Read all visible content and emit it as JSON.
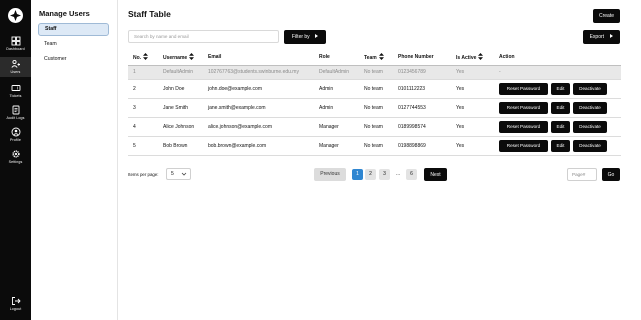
{
  "nav": {
    "items": [
      {
        "label": "Dashboard",
        "icon": "dashboard-icon"
      },
      {
        "label": "Users",
        "icon": "users-icon"
      },
      {
        "label": "Tickets",
        "icon": "ticket-icon"
      },
      {
        "label": "Audit Logs",
        "icon": "audit-log-icon"
      },
      {
        "label": "Profile",
        "icon": "profile-icon"
      },
      {
        "label": "Settings",
        "icon": "settings-icon"
      }
    ],
    "logout_label": "Logout"
  },
  "sidebar": {
    "title": "Manage Users",
    "items": [
      {
        "label": "Staff"
      },
      {
        "label": "Team"
      },
      {
        "label": "Customer"
      }
    ]
  },
  "main": {
    "title": "Staff Table",
    "create_label": "Create",
    "search_placeholder": "Search by name and email",
    "filter_label": "Filter by",
    "export_label": "Export"
  },
  "table": {
    "columns": [
      "No.",
      "Username",
      "Email",
      "Role",
      "Team",
      "Phone Number",
      "Is Active",
      "Action"
    ],
    "rows": [
      {
        "no": "1",
        "username": "DefaultAdmin",
        "email": "102767763@students.swinburne.edu.my",
        "role": "DefaultAdmin",
        "team": "No team",
        "phone": "0123456789",
        "active": "Yes",
        "action": "-"
      },
      {
        "no": "2",
        "username": "John Doe",
        "email": "john.doe@example.com",
        "role": "Admin",
        "team": "No team",
        "phone": "0101112223",
        "active": "Yes"
      },
      {
        "no": "3",
        "username": "Jane Smith",
        "email": "jane.smith@example.com",
        "role": "Admin",
        "team": "No team",
        "phone": "0127744553",
        "active": "Yes"
      },
      {
        "no": "4",
        "username": "Alice Johnson",
        "email": "alice.johnson@example.com",
        "role": "Manager",
        "team": "No team",
        "phone": "0189998574",
        "active": "Yes"
      },
      {
        "no": "5",
        "username": "Bob Brown",
        "email": "bob.brown@example.com",
        "role": "Manager",
        "team": "No team",
        "phone": "0198898869",
        "active": "Yes"
      }
    ],
    "action_labels": {
      "reset": "Reset Password",
      "edit": "Edit",
      "deactivate": "Deactivate"
    }
  },
  "pagination": {
    "items_per_page_label": "Items per page:",
    "items_per_page_value": "5",
    "previous_label": "Previous",
    "pages": [
      "1",
      "2",
      "3",
      "...",
      "6"
    ],
    "current_page": "1",
    "next_label": "Next",
    "page_input_placeholder": "Page#",
    "go_label": "Go"
  },
  "colors": {
    "accent": "#2f86d1",
    "dark": "#0b0b0b",
    "active_tab": "#dde9f6"
  }
}
